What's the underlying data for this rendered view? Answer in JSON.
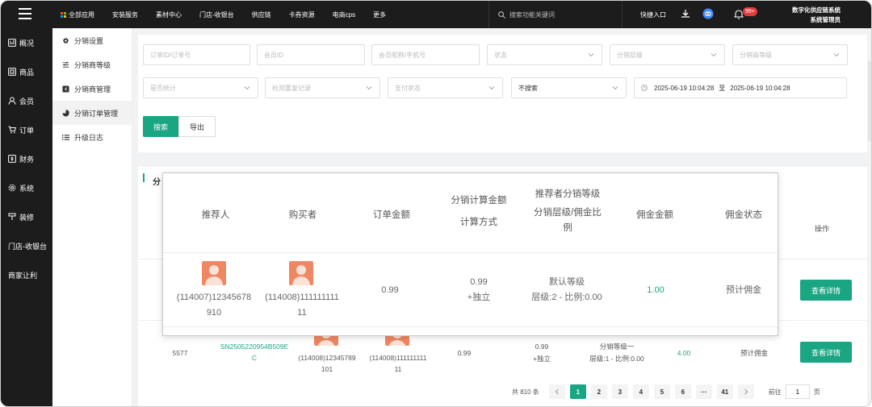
{
  "topbar": {
    "nav": [
      "全部应用",
      "安装服务",
      "素材中心",
      "门店-收银台",
      "供应链",
      "卡券资源",
      "电商cps",
      "更多"
    ],
    "search_placeholder": "搜索功能关键词",
    "quick_entry": "快捷入口",
    "badge": "99+",
    "user_line1": "数字化供应链系统",
    "user_line2": "系统管理员"
  },
  "sidebar": {
    "items": [
      {
        "label": "概况",
        "icon": "dashboard-icon"
      },
      {
        "label": "商品",
        "icon": "product-icon"
      },
      {
        "label": "会员",
        "icon": "member-icon"
      },
      {
        "label": "订单",
        "icon": "cart-icon"
      },
      {
        "label": "财务",
        "icon": "finance-icon"
      },
      {
        "label": "系统",
        "icon": "gear-icon"
      },
      {
        "label": "装修",
        "icon": "brush-icon"
      },
      {
        "label": "门店-收银台",
        "icon": ""
      },
      {
        "label": "商家让利",
        "icon": ""
      }
    ]
  },
  "submenu": {
    "items": [
      {
        "label": "分销设置"
      },
      {
        "label": "分销商等级"
      },
      {
        "label": "分销商管理"
      },
      {
        "label": "分销订单管理"
      },
      {
        "label": "升级日志"
      }
    ]
  },
  "filters": {
    "order_id": "订单ID/订单号",
    "member_id": "会员ID",
    "member_nick": "会员昵称/手机号",
    "status": "状态",
    "level": "分销层级",
    "dist_level": "分销商等级",
    "is_stat": "是否统计",
    "dup_check": "检测重复记录",
    "pay_status": "支付状态",
    "no_search": "不搜索",
    "date_start": "2025-06-19 10:04:28",
    "date_sep": "至",
    "date_end": "2025-06-19 10:04:28",
    "search_btn": "搜索",
    "export_btn": "导出"
  },
  "table": {
    "title": "分",
    "op_header": "操作",
    "detail_btn": "查看详情",
    "row2": {
      "id": "5577",
      "order_no": "SN2505220954B509EC",
      "referrer": "(114008)12345789101",
      "buyer": "(114008)11111111111",
      "amount": "0.99",
      "calc_amount": "0.99",
      "calc_method": "+独立",
      "level": "分销等级一",
      "ratio": "层级:1 - 比例:0.00",
      "commission": "4.00",
      "commission_status": "预计佣金"
    }
  },
  "pager": {
    "total": "共 810 条",
    "pages": [
      "1",
      "2",
      "3",
      "4",
      "5",
      "6",
      "···",
      "41"
    ],
    "goto_label": "前往",
    "goto_value": "1",
    "page_unit": "页"
  },
  "popup": {
    "h_referrer": "推荐人",
    "h_buyer": "购买者",
    "h_amount": "订单金额",
    "h_calc1": "分销计算金额",
    "h_calc2": "计算方式",
    "h_level1": "推荐者分销等级",
    "h_level2": "分销层级/佣金比例",
    "h_commission": "佣金金额",
    "h_status": "佣金状态",
    "referrer": "(114007)12345678910",
    "buyer": "(114008)11111111111",
    "amount": "0.99",
    "calc_amount": "0.99",
    "calc_method": "+独立",
    "level": "默认等级",
    "ratio": "层级:2 - 比例:0.00",
    "commission": "1.00",
    "status": "预计佣金"
  },
  "colors": {
    "accent": "#1aa683",
    "dark": "#1c1c1c",
    "badge": "#e23b3b",
    "avatar": "#f08763"
  }
}
